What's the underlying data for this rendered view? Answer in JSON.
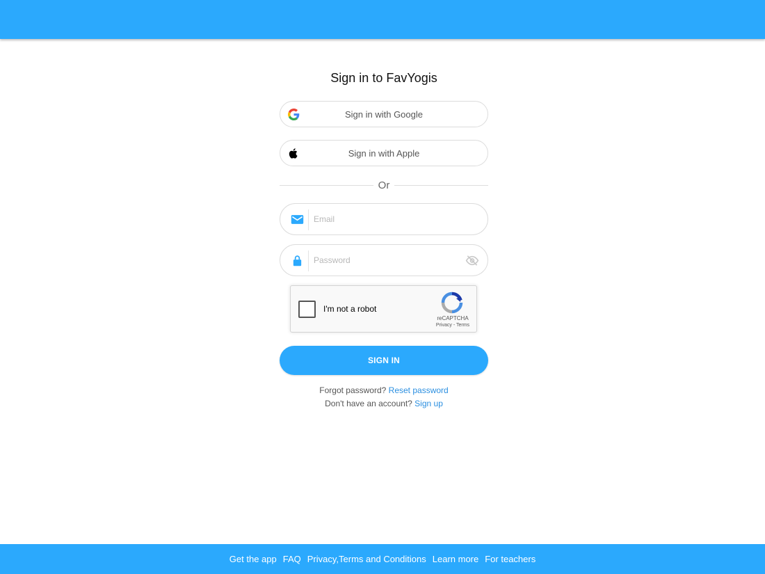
{
  "title": "Sign in to FavYogis",
  "social": {
    "google_label": "Sign in with Google",
    "apple_label": "Sign in with Apple"
  },
  "divider_text": "Or",
  "email": {
    "placeholder": "Email",
    "value": "",
    "icon": "mail-icon"
  },
  "password": {
    "placeholder": "Password",
    "value": "",
    "icon": "lock-icon",
    "toggle_icon": "eye-off-icon"
  },
  "captcha": {
    "label": "I'm not a robot",
    "brand": "reCAPTCHA",
    "privacy": "Privacy",
    "separator": "-",
    "terms": "Terms"
  },
  "signin_label": "SIGN IN",
  "help": {
    "forgot_text": "Forgot password?",
    "reset_link": "Reset password",
    "no_account_text": "Don't have an account?",
    "signup_link": "Sign up"
  },
  "footer": {
    "links": [
      "Get the app",
      "FAQ",
      "Privacy,Terms and Conditions",
      "Learn more",
      "For teachers"
    ]
  },
  "colors": {
    "brand": "#2ba9fd",
    "link": "#2b8fe0"
  }
}
